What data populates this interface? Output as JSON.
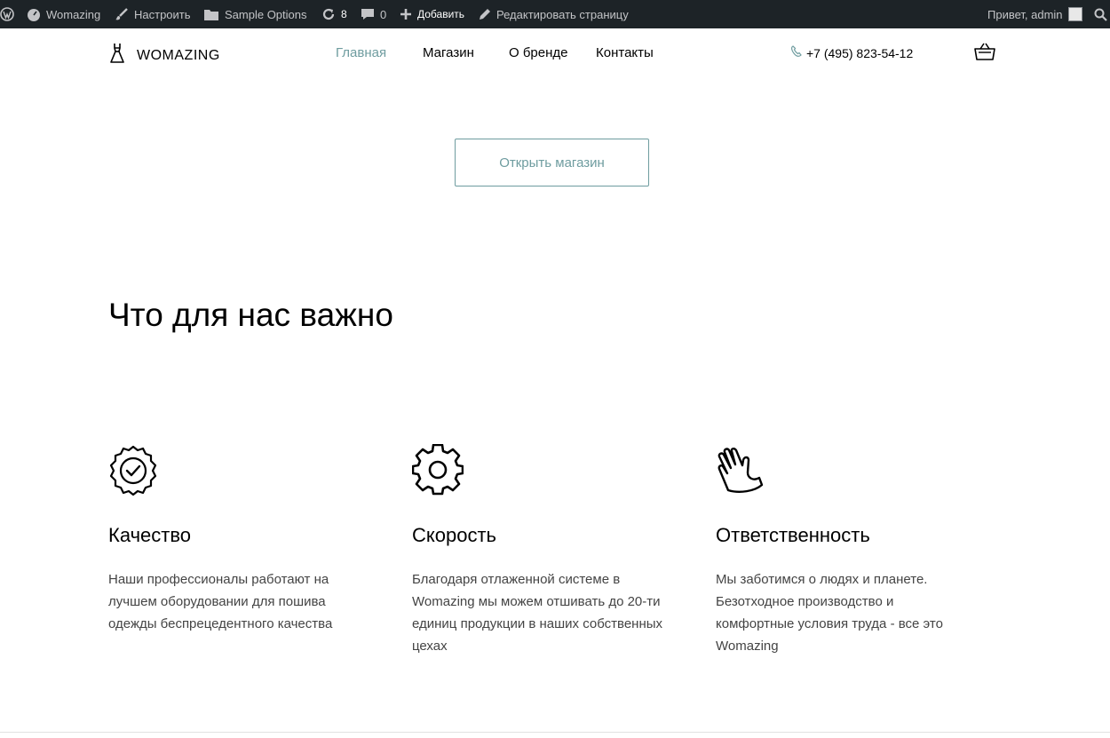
{
  "admin_bar": {
    "site_name": "Womazing",
    "customize": "Настроить",
    "sample_options": "Sample Options",
    "updates_count": "8",
    "comments_count": "0",
    "add_new": "Добавить",
    "edit_page": "Редактировать страницу",
    "greeting": "Привет, admin"
  },
  "header": {
    "logo_text": "WOMAZING",
    "nav": [
      "Главная",
      "Магазин",
      "О бренде",
      "Контакты"
    ],
    "phone": "+7 (495) 823-54-12"
  },
  "hero": {
    "open_shop": "Открыть магазин"
  },
  "values": {
    "title": "Что для нас важно",
    "items": [
      {
        "icon": "quality-badge-icon",
        "title": "Качество",
        "text": "Наши профессионалы работают на лучшем оборудовании для пошива одежды беспрецедентного качества"
      },
      {
        "icon": "gear-icon",
        "title": "Скорость",
        "text": "Благодаря отлаженной системе в Womazing мы можем отшивать до 20-ти единиц продукции в наших собственных цехах"
      },
      {
        "icon": "hand-icon",
        "title": "Ответственность",
        "text": "Мы заботимся о людях и планете. Безотходное производство и комфортные условия труда - все это Womazing"
      }
    ]
  },
  "colors": {
    "accent": "#6e9c9f",
    "admin_bar_bg": "#1d2327"
  }
}
